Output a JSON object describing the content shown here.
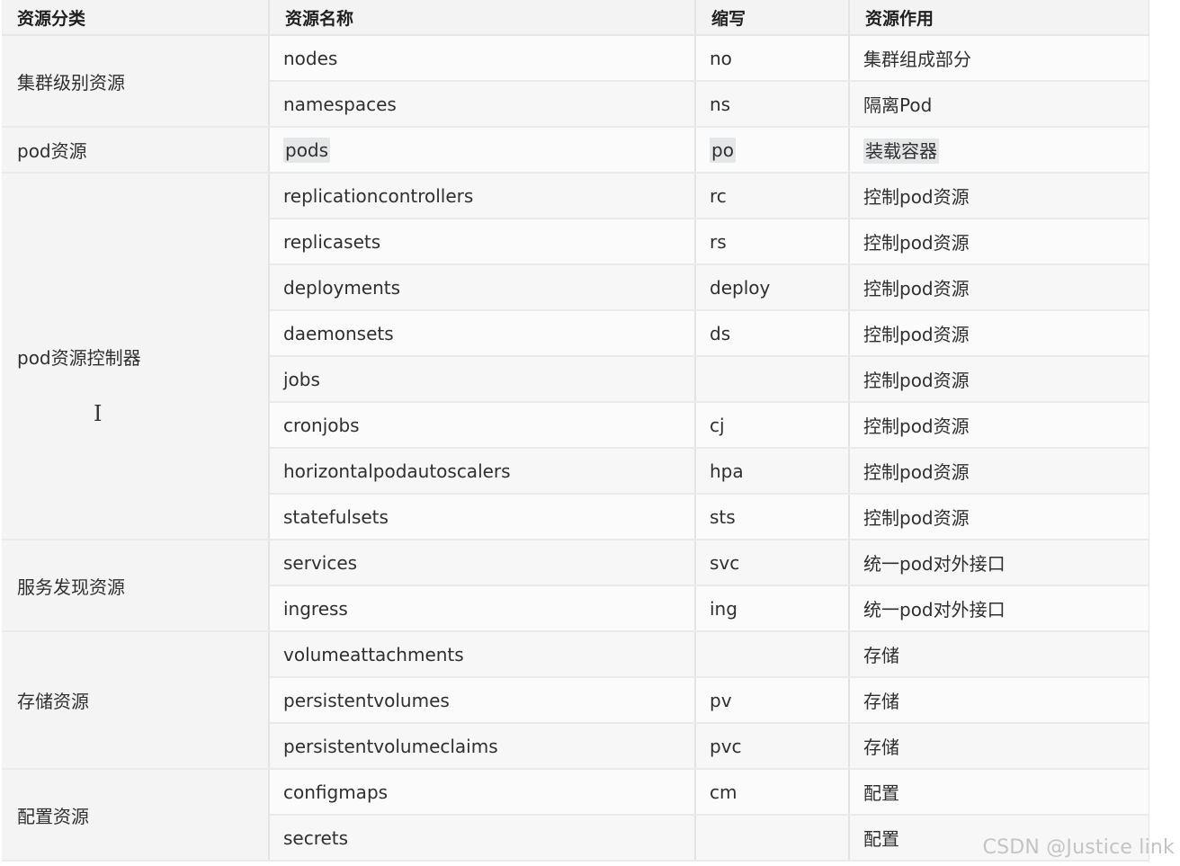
{
  "table": {
    "headers": [
      "资源分类",
      "资源名称",
      "缩写",
      "资源作用"
    ],
    "groups": [
      {
        "category": "集群级别资源",
        "rows": [
          {
            "name": "nodes",
            "abbr": "no",
            "purpose": "集群组成部分"
          },
          {
            "name": "namespaces",
            "abbr": "ns",
            "purpose": "隔离Pod"
          }
        ]
      },
      {
        "category": "pod资源",
        "rows": [
          {
            "name": "pods",
            "abbr": "po",
            "purpose": "装载容器",
            "highlighted": true
          }
        ]
      },
      {
        "category": "pod资源控制器",
        "rows": [
          {
            "name": "replicationcontrollers",
            "abbr": "rc",
            "purpose": "控制pod资源"
          },
          {
            "name": "replicasets",
            "abbr": "rs",
            "purpose": "控制pod资源"
          },
          {
            "name": "deployments",
            "abbr": "deploy",
            "purpose": "控制pod资源"
          },
          {
            "name": "daemonsets",
            "abbr": "ds",
            "purpose": "控制pod资源"
          },
          {
            "name": "jobs",
            "abbr": "",
            "purpose": "控制pod资源"
          },
          {
            "name": "cronjobs",
            "abbr": "cj",
            "purpose": "控制pod资源"
          },
          {
            "name": "horizontalpodautoscalers",
            "abbr": "hpa",
            "purpose": "控制pod资源"
          },
          {
            "name": "statefulsets",
            "abbr": "sts",
            "purpose": "控制pod资源"
          }
        ]
      },
      {
        "category": "服务发现资源",
        "rows": [
          {
            "name": "services",
            "abbr": "svc",
            "purpose": "统一pod对外接口"
          },
          {
            "name": "ingress",
            "abbr": "ing",
            "purpose": "统一pod对外接口"
          }
        ]
      },
      {
        "category": "存储资源",
        "rows": [
          {
            "name": "volumeattachments",
            "abbr": "",
            "purpose": "存储"
          },
          {
            "name": "persistentvolumes",
            "abbr": "pv",
            "purpose": "存储"
          },
          {
            "name": "persistentvolumeclaims",
            "abbr": "pvc",
            "purpose": "存储"
          }
        ]
      },
      {
        "category": "配置资源",
        "rows": [
          {
            "name": "configmaps",
            "abbr": "cm",
            "purpose": "配置"
          },
          {
            "name": "secrets",
            "abbr": "",
            "purpose": "配置"
          }
        ]
      }
    ]
  },
  "cursor": {
    "glyph": "I"
  },
  "watermark": "CSDN @Justice link"
}
